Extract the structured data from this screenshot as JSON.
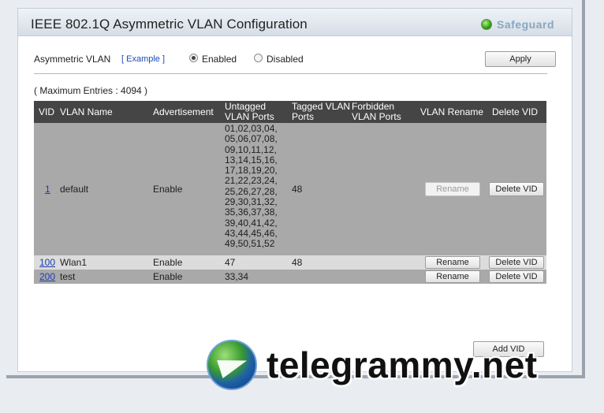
{
  "title": "IEEE 802.1Q Asymmetric VLAN Configuration",
  "brand": {
    "label": "Safeguard"
  },
  "asym": {
    "label": "Asymmetric VLAN",
    "example_link": "[ Example ]",
    "enabled_label": "Enabled",
    "disabled_label": "Disabled",
    "selected": "Enabled",
    "apply_label": "Apply"
  },
  "max_entries": "( Maximum Entries : 4094 )",
  "table": {
    "headers": {
      "vid": "VID",
      "vlan_name": "VLAN Name",
      "advertisement": "Advertisement",
      "untagged_l1": "Untagged",
      "untagged_l2": "VLAN Ports",
      "tagged_l1": "Tagged VLAN",
      "tagged_l2": "Ports",
      "forbidden_l1": "Forbidden",
      "forbidden_l2": "VLAN Ports",
      "rename": "VLAN Rename",
      "delete": "Delete VID"
    },
    "rows": [
      {
        "vid": "1",
        "name": "default",
        "advertisement": "Enable",
        "untagged": "01,02,03,04,\n05,06,07,08,\n09,10,11,12,\n13,14,15,16,\n17,18,19,20,\n21,22,23,24,\n25,26,27,28,\n29,30,31,32,\n35,36,37,38,\n39,40,41,42,\n43,44,45,46,\n49,50,51,52",
        "tagged": "48",
        "forbidden": "",
        "rename_label": "Rename",
        "delete_label": "Delete VID"
      },
      {
        "vid": "100",
        "name": "Wlan1",
        "advertisement": "Enable",
        "untagged": "47",
        "tagged": "48",
        "forbidden": "",
        "rename_label": "Rename",
        "delete_label": "Delete VID"
      },
      {
        "vid": "200",
        "name": "test",
        "advertisement": "Enable",
        "untagged": "33,34",
        "tagged": "",
        "forbidden": "",
        "rename_label": "Rename",
        "delete_label": "Delete VID"
      }
    ]
  },
  "add_vid_label": "Add VID",
  "watermark": {
    "text": "telegrammy.net"
  },
  "colors": {
    "header_bg": "#454545",
    "row_dark": "#a9a9a9",
    "row_light": "#dcdcdc",
    "link": "#1b3fb0"
  }
}
